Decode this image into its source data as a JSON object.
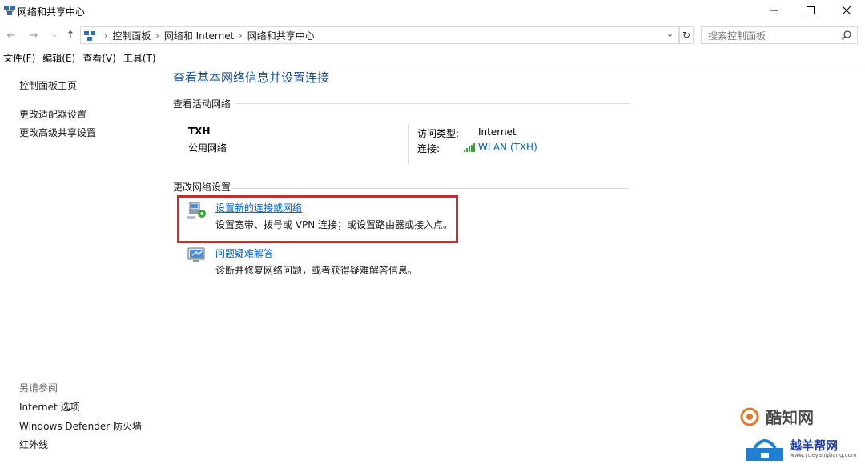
{
  "window": {
    "title": "网络和共享中心"
  },
  "address": {
    "crumbs": [
      "控制面板",
      "网络和 Internet",
      "网络和共享中心"
    ],
    "search_placeholder": "搜索控制面板"
  },
  "menu": [
    "文件(F)",
    "编辑(E)",
    "查看(V)",
    "工具(T)"
  ],
  "sidebar": {
    "home": "控制面板主页",
    "adapter": "更改适配器设置",
    "advanced": "更改高级共享设置",
    "see_also_title": "另请参阅",
    "see_also": [
      "Internet 选项",
      "Windows Defender 防火墙",
      "红外线"
    ]
  },
  "main": {
    "title": "查看基本网络信息并设置连接",
    "active_networks_heading": "查看活动网络",
    "network": {
      "name": "TXH",
      "type": "公用网络",
      "access_label": "访问类型:",
      "access_value": "Internet",
      "connection_label": "连接:",
      "connection_value": "WLAN (TXH)"
    },
    "change_heading": "更改网络设置",
    "tasks": [
      {
        "link": "设置新的连接或网络",
        "desc": "设置宽带、拨号或 VPN 连接；或设置路由器或接入点。"
      },
      {
        "link": "问题疑难解答",
        "desc": "诊断并修复网络问题，或者获得疑难解答信息。"
      }
    ]
  },
  "watermark": {
    "text1": "酷知网",
    "text2": "越羊帮网",
    "url": "www.yueyangbang.com"
  },
  "colors": {
    "link": "#0066cc",
    "title": "#1e4e8c",
    "highlight": "#d22a2a",
    "signal": "#3aa33a"
  }
}
